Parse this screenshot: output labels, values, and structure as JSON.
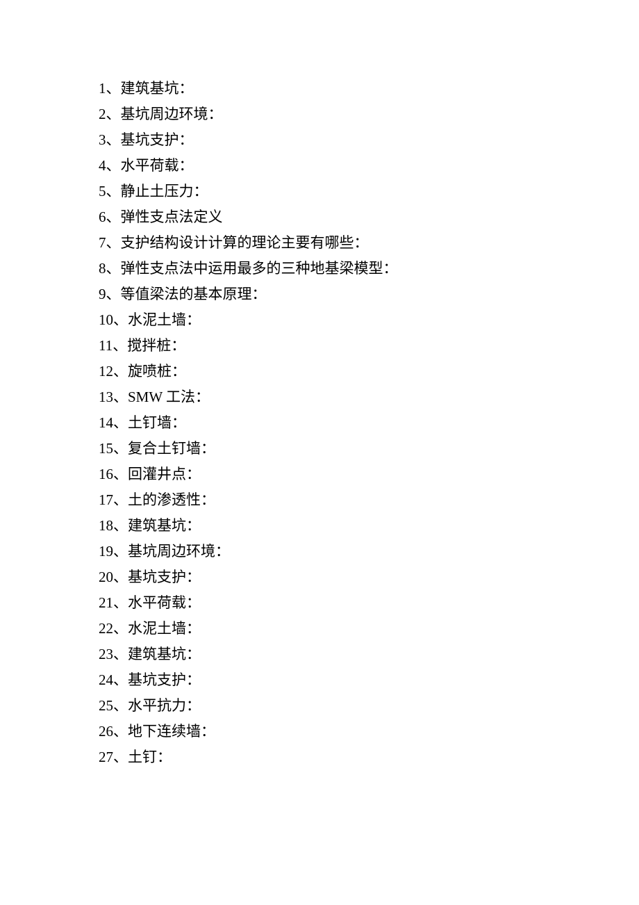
{
  "items": [
    {
      "number": "1、",
      "text": "建筑基坑："
    },
    {
      "number": "2、",
      "text": "基坑周边环境："
    },
    {
      "number": "3、",
      "text": "基坑支护："
    },
    {
      "number": "4、",
      "text": "水平荷载："
    },
    {
      "number": "5、",
      "text": "静止土压力："
    },
    {
      "number": "6、",
      "text": "弹性支点法定义"
    },
    {
      "number": "7、",
      "text": "支护结构设计计算的理论主要有哪些："
    },
    {
      "number": "8、",
      "text": "弹性支点法中运用最多的三种地基梁模型："
    },
    {
      "number": "9、",
      "text": "等值梁法的基本原理："
    },
    {
      "number": "10、",
      "text": "水泥土墙："
    },
    {
      "number": "11、",
      "text": "搅拌桩："
    },
    {
      "number": "12、",
      "text": "旋喷桩："
    },
    {
      "number": "13、",
      "text": "SMW 工法："
    },
    {
      "number": "14、",
      "text": "土钉墙："
    },
    {
      "number": "15、",
      "text": "复合土钉墙："
    },
    {
      "number": "16、",
      "text": "回灌井点："
    },
    {
      "number": "17、",
      "text": "土的渗透性："
    },
    {
      "number": "18、",
      "text": "建筑基坑："
    },
    {
      "number": "19、",
      "text": "基坑周边环境："
    },
    {
      "number": "20、",
      "text": "基坑支护："
    },
    {
      "number": "21、",
      "text": "水平荷载："
    },
    {
      "number": "22、",
      "text": "水泥土墙："
    },
    {
      "number": "23、",
      "text": "建筑基坑："
    },
    {
      "number": "24、",
      "text": "基坑支护："
    },
    {
      "number": "25、",
      "text": "水平抗力："
    },
    {
      "number": "26、",
      "text": "地下连续墙："
    },
    {
      "number": "27、",
      "text": "土钉："
    }
  ]
}
